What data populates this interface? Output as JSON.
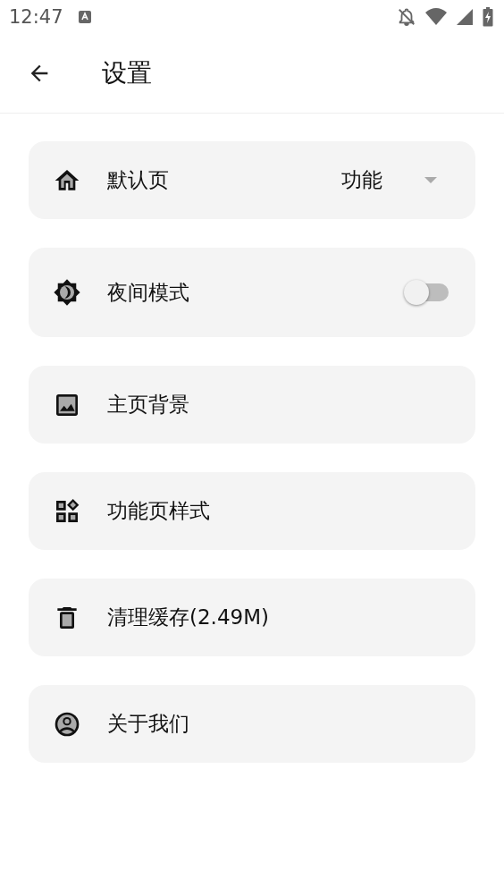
{
  "status_bar": {
    "time": "12:47"
  },
  "toolbar": {
    "title": "设置"
  },
  "settings": [
    {
      "kind": "select",
      "label": "默认页",
      "value": "功能"
    },
    {
      "kind": "switch",
      "label": "夜间模式",
      "on": false
    },
    {
      "kind": "link",
      "label": "主页背景"
    },
    {
      "kind": "link",
      "label": "功能页样式"
    },
    {
      "kind": "link",
      "label": "清理缓存(2.49M)"
    },
    {
      "kind": "link",
      "label": "关于我们"
    }
  ]
}
